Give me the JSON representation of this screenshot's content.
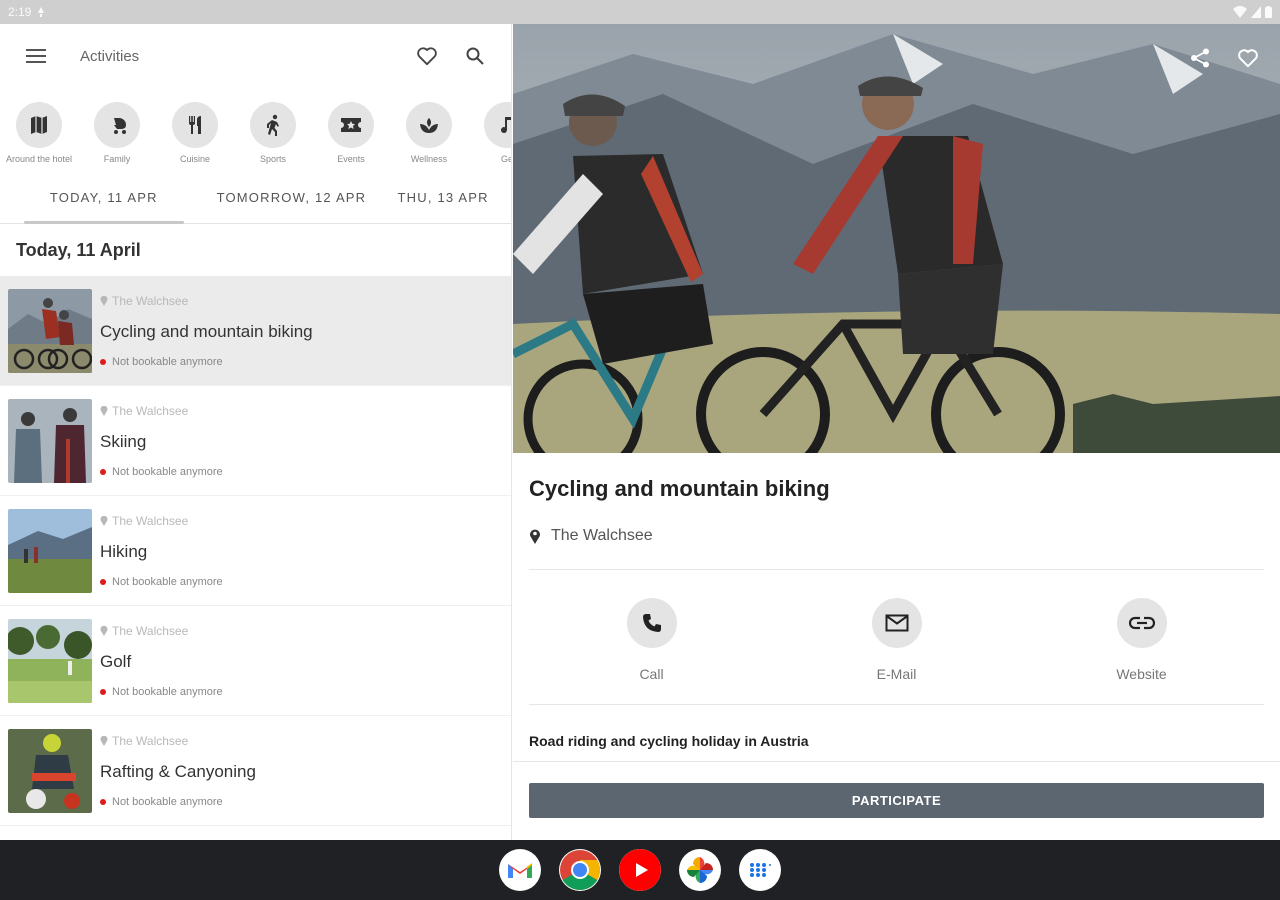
{
  "status_bar": {
    "time": "2:19"
  },
  "app_bar": {
    "title": "Activities"
  },
  "categories": [
    {
      "label": "Around the hotel",
      "icon": "map-icon"
    },
    {
      "label": "Family",
      "icon": "stroller-icon"
    },
    {
      "label": "Cuisine",
      "icon": "cutlery-icon"
    },
    {
      "label": "Sports",
      "icon": "running-icon"
    },
    {
      "label": "Events",
      "icon": "ticket-icon"
    },
    {
      "label": "Wellness",
      "icon": "spa-icon"
    },
    {
      "label": "Ge",
      "icon": "music-icon"
    }
  ],
  "date_tabs": [
    {
      "label": "TODAY, 11 APR",
      "active": true
    },
    {
      "label": "TOMORROW, 12 APR",
      "active": false
    },
    {
      "label": "THU, 13 APR",
      "active": false
    }
  ],
  "day_heading": "Today, 11 April",
  "list_items": [
    {
      "location": "The Walchsee",
      "title": "Cycling and mountain biking",
      "status": "Not bookable anymore"
    },
    {
      "location": "The Walchsee",
      "title": "Skiing",
      "status": "Not bookable anymore"
    },
    {
      "location": "The Walchsee",
      "title": "Hiking",
      "status": "Not bookable anymore"
    },
    {
      "location": "The Walchsee",
      "title": "Golf",
      "status": "Not bookable anymore"
    },
    {
      "location": "The Walchsee",
      "title": "Rafting & Canyoning",
      "status": "Not bookable anymore"
    }
  ],
  "detail": {
    "title": "Cycling and mountain biking",
    "location": "The Walchsee",
    "contacts": [
      {
        "label": "Call",
        "icon": "phone-icon"
      },
      {
        "label": "E-Mail",
        "icon": "mail-icon"
      },
      {
        "label": "Website",
        "icon": "link-icon"
      }
    ],
    "description": "Road riding and cycling holiday in Austria",
    "participate_label": "PARTICIPATE"
  },
  "colors": {
    "status_dot": "#e01b1b",
    "participate_bg": "#5c6670",
    "taskbar_bg": "#202124"
  }
}
